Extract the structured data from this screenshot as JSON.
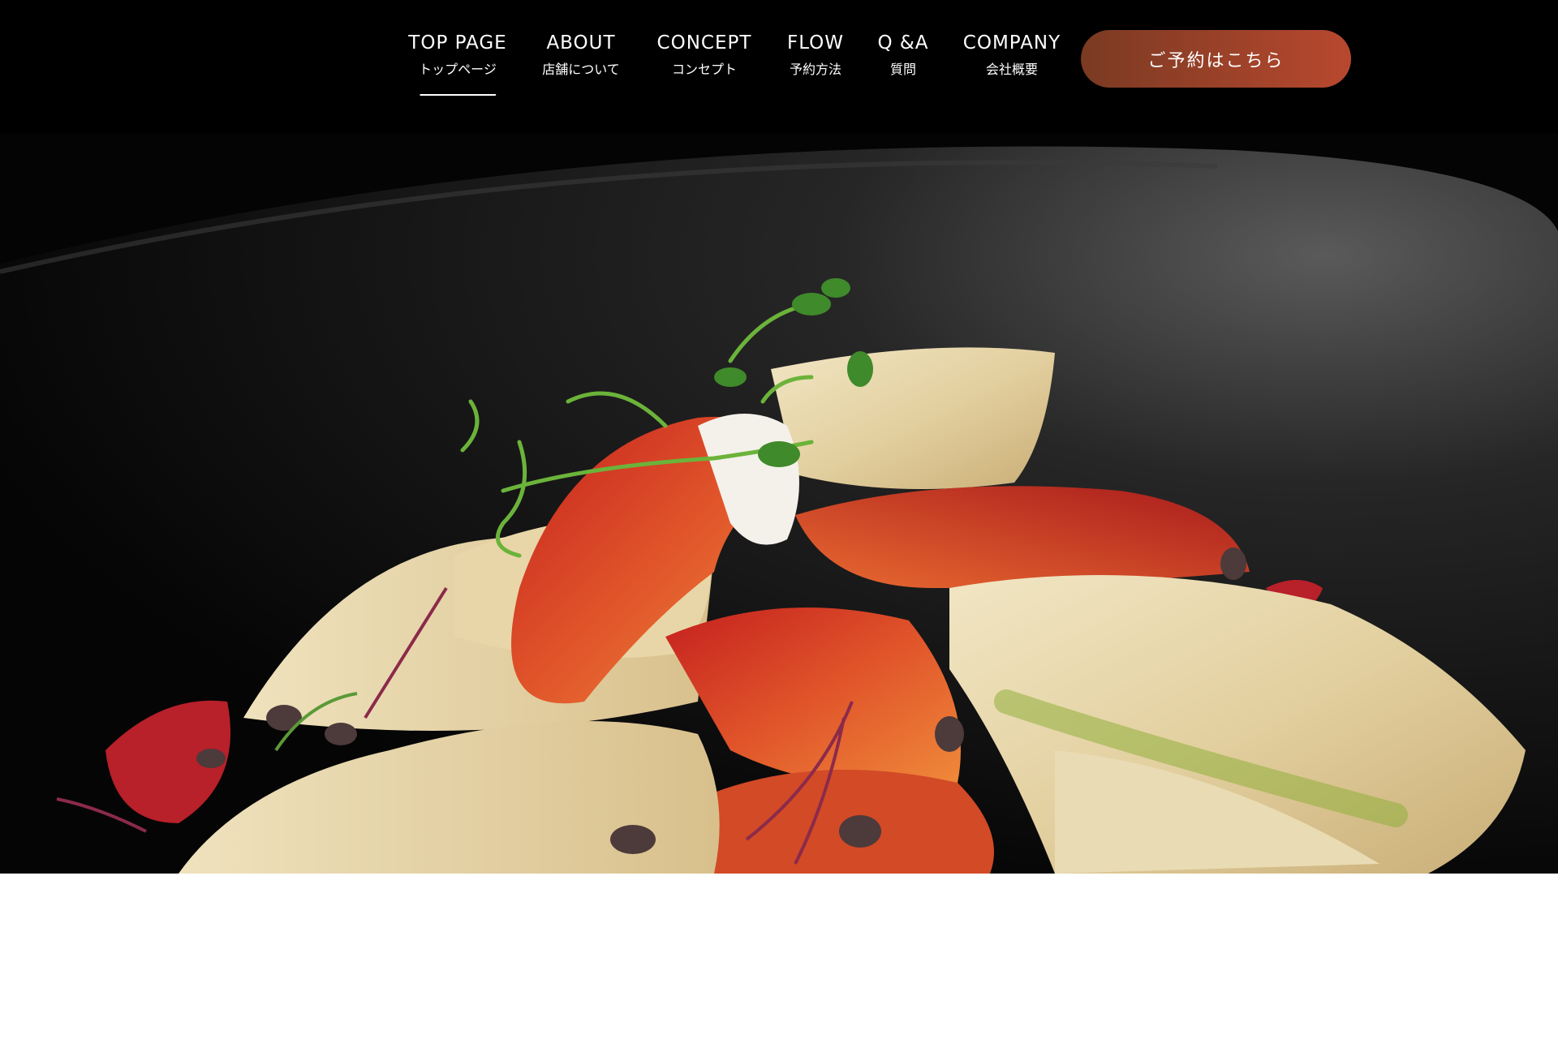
{
  "nav": {
    "items": [
      {
        "en": "TOP PAGE",
        "jp": "トップページ",
        "active": true
      },
      {
        "en": "ABOUT",
        "jp": "店舗について",
        "active": false
      },
      {
        "en": "CONCEPT",
        "jp": "コンセプト",
        "active": false
      },
      {
        "en": "FLOW",
        "jp": "予約方法",
        "active": false
      },
      {
        "en": "Q &A",
        "jp": "質問",
        "active": false
      },
      {
        "en": "COMPANY",
        "jp": "会社概要",
        "active": false
      }
    ],
    "cta_label": "ご予約はこちら"
  },
  "colors": {
    "header_bg": "#000000",
    "cta_gradient_start": "#7a3a22",
    "cta_gradient_end": "#b8482f"
  },
  "hero": {
    "image_subject": "crepes-with-carrot-ribbons-and-microgreens-photo"
  }
}
